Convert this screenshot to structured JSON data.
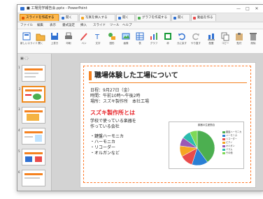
{
  "window": {
    "title": "■ 工場見学報告会.pptx - PowerPoint",
    "controls": [
      "—",
      "□",
      "✕"
    ]
  },
  "tabs": [
    {
      "label": "スライドを作成する",
      "active": true
    },
    {
      "label": "開く",
      "active": false
    },
    {
      "label": "写真を挿入する",
      "active": false
    },
    {
      "label": "開く",
      "active": false
    },
    {
      "label": "グラフを作成する",
      "active": false
    },
    {
      "label": "開く",
      "active": false
    },
    {
      "label": "動画を作る",
      "active": false
    }
  ],
  "menu": [
    "ファイル",
    "編集",
    "表示",
    "書式設定",
    "挿入",
    "スライド",
    "ツール",
    "ヘルプ"
  ],
  "toolbar": [
    {
      "icon": "new-slide-icon",
      "label": "新しいスライド"
    },
    {
      "icon": "open-icon",
      "label": "開く"
    },
    {
      "icon": "save-icon",
      "label": "上書き"
    },
    {
      "icon": "print-icon",
      "label": "印刷"
    },
    {
      "icon": "pen-icon",
      "label": "ペン"
    },
    {
      "icon": "text-icon",
      "label": "文字"
    },
    {
      "icon": "shape-icon",
      "label": "図形"
    },
    {
      "icon": "picture-icon",
      "label": "画像"
    },
    {
      "icon": "table-icon",
      "label": "表"
    },
    {
      "icon": "chart-icon",
      "label": "グラフ"
    },
    {
      "icon": "frame-icon",
      "label": "枠"
    },
    {
      "icon": "undo-icon",
      "label": "元に戻す"
    },
    {
      "icon": "redo-icon",
      "label": "やり直す"
    },
    {
      "icon": "align-icon",
      "label": "配置"
    },
    {
      "icon": "copy-icon",
      "label": "コピー"
    },
    {
      "icon": "paste-icon",
      "label": "貼付"
    },
    {
      "icon": "delete-icon",
      "label": "削除"
    }
  ],
  "colors": {
    "accent": "#f58220",
    "tab_active": "#ffb84d",
    "heading_red": "#e8262b"
  },
  "slide": {
    "title": "職場体験した工場について",
    "info_lines": [
      "日程：9月27日（金）",
      "時間：午前10時〜午後2時",
      "場所：スズキ製作所　本社工場"
    ],
    "subheading": "スズキ製作所とは",
    "body_lines": [
      "学校で使っている楽器を",
      "作っている会社"
    ],
    "bullets": [
      "・鍵盤ハーモニカ",
      "・ハーモニカ",
      "・リコーダー",
      "・オルガンなど"
    ]
  },
  "chart_data": {
    "type": "pie",
    "title": "楽器の生産割合",
    "slices": [
      {
        "name": "鍵盤ハーモニカ",
        "value": 40,
        "color": "#4caf50"
      },
      {
        "name": "ハーモニカ",
        "value": 15,
        "color": "#2a7fd4"
      },
      {
        "name": "リコーダー",
        "value": 12,
        "color": "#e94b4b"
      },
      {
        "name": "ピアノ",
        "value": 10,
        "color": "#f5a623"
      },
      {
        "name": "オルガン",
        "value": 8,
        "color": "#9b59b6"
      },
      {
        "name": "ドラム",
        "value": 8,
        "color": "#2bbbad"
      },
      {
        "name": "その他",
        "value": 7,
        "color": "#7ed957"
      }
    ]
  }
}
